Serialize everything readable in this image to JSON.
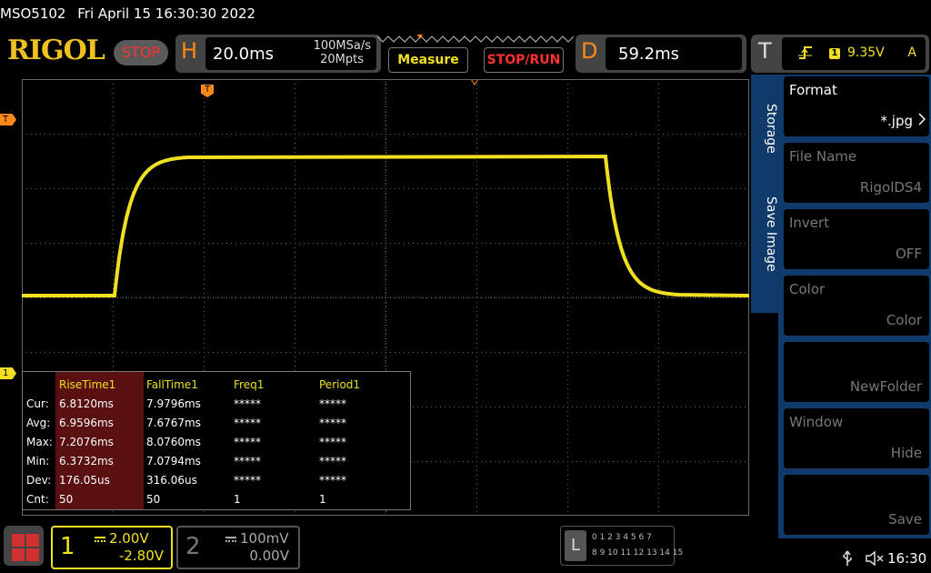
{
  "titlebar": {
    "model": "MSO5102",
    "datetime": "Fri April 15 16:30:30 2022"
  },
  "toolbar": {
    "logo": "RIGOL",
    "run_state": "STOP",
    "horizontal": {
      "letter": "H",
      "timebase": "20.0ms",
      "sample_rate": "100MSa/s",
      "memory_depth": "20Mpts"
    },
    "measure_label": "Measure",
    "stoprun_label": "STOP/RUN",
    "delay": {
      "letter": "D",
      "value": "59.2ms"
    },
    "trigger": {
      "letter": "T",
      "edge_icon": "rising-edge-icon",
      "source_badge": "1",
      "level": "9.35V",
      "coupling": "A"
    }
  },
  "markers": {
    "trigger_marker": "T",
    "ch1_marker": "1"
  },
  "waveform": {
    "color": "#f0e020",
    "low_level_div": 0,
    "high_level_div": 2.55
  },
  "measurements": {
    "columns": [
      "RiseTime1",
      "FallTime1",
      "Freq1",
      "Period1"
    ],
    "rows": [
      {
        "label": "Cur:",
        "values": [
          "6.8120ms",
          "7.9796ms",
          "*****",
          "*****"
        ]
      },
      {
        "label": "Avg:",
        "values": [
          "6.9596ms",
          "7.6767ms",
          "*****",
          "*****"
        ]
      },
      {
        "label": "Max:",
        "values": [
          "7.2076ms",
          "8.0760ms",
          "*****",
          "*****"
        ]
      },
      {
        "label": "Min:",
        "values": [
          "6.3732ms",
          "7.0794ms",
          "*****",
          "*****"
        ]
      },
      {
        "label": "Dev:",
        "values": [
          "176.05us",
          "316.06us",
          "*****",
          "*****"
        ]
      },
      {
        "label": "Cnt:",
        "values": [
          "50",
          "50",
          "1",
          "1"
        ]
      }
    ]
  },
  "side_menu": {
    "tabs": [
      "Storage",
      "Save Image"
    ],
    "items": [
      {
        "title": "Format",
        "value": "*.jpg",
        "enabled": true
      },
      {
        "title": "File Name",
        "value": "RigolDS4",
        "enabled": false
      },
      {
        "title": "Invert",
        "value": "OFF",
        "enabled": false
      },
      {
        "title": "Color",
        "value": "Color",
        "enabled": false
      },
      {
        "title": "",
        "value": "NewFolder",
        "enabled": false
      },
      {
        "title": "Window",
        "value": "Hide",
        "enabled": false
      },
      {
        "title": "",
        "value": "Save",
        "enabled": false
      }
    ]
  },
  "bottom": {
    "ch1": {
      "num": "1",
      "scale": "2.00V",
      "offset": "-2.80V"
    },
    "ch2": {
      "num": "2",
      "scale": "100mV",
      "offset": "0.00V"
    },
    "logic": {
      "letter": "L",
      "row1": "0 1 2 3  4 5 6 7",
      "row2": "8 9 10 11 12 13 14 15"
    },
    "clock": "16:30"
  }
}
